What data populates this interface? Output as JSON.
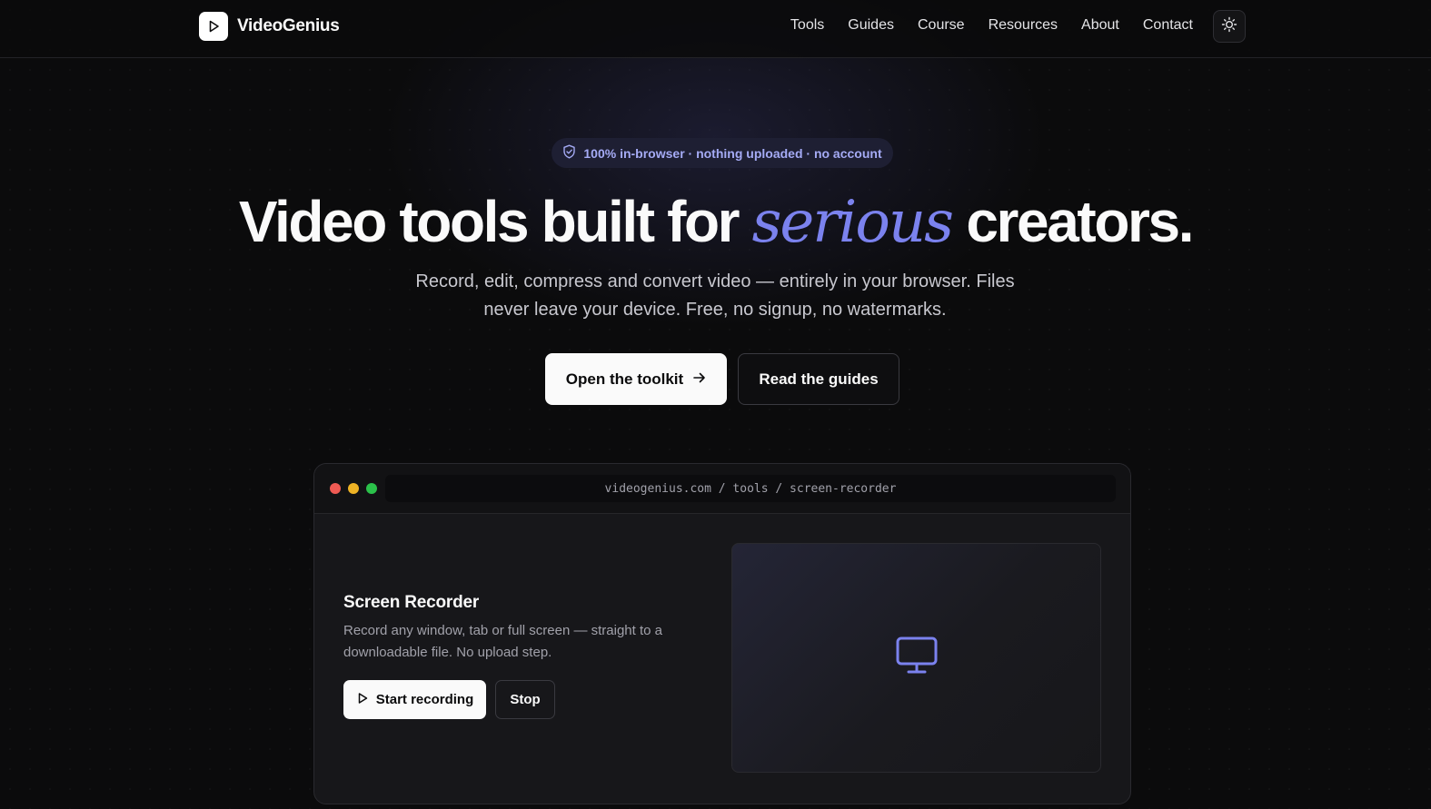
{
  "brand": {
    "name": "VideoGenius"
  },
  "nav": {
    "items": [
      {
        "label": "Tools"
      },
      {
        "label": "Guides"
      },
      {
        "label": "Course"
      },
      {
        "label": "Resources"
      },
      {
        "label": "About"
      },
      {
        "label": "Contact"
      }
    ],
    "theme_toggle_icon": "sun-icon"
  },
  "hero": {
    "badge": "100% in-browser · nothing uploaded · no account",
    "badge_icon": "shield-check-icon",
    "headline_before": "Video tools built for ",
    "headline_accent": "serious",
    "headline_after": " creators.",
    "subheadline": "Record, edit, compress and convert video — entirely in your browser. Files never leave your device. Free, no signup, no watermarks.",
    "primary_cta": "Open the toolkit",
    "secondary_cta": "Read the guides"
  },
  "demo_window": {
    "url": "videogenius.com / tools / screen-recorder",
    "tool_title": "Screen Recorder",
    "tool_description": "Record any window, tab or full screen — straight to a downloadable file. No upload step.",
    "start_label": "Start recording",
    "stop_label": "Stop",
    "preview_icon": "monitor-icon"
  },
  "colors": {
    "background": "#0b0b0c",
    "accent": "#7b82ee",
    "badge_bg": "#1e1f33",
    "badge_text": "#a5abf5",
    "traffic_red": "#ef5a53",
    "traffic_yellow": "#eeb325",
    "traffic_green": "#2bc14a"
  }
}
